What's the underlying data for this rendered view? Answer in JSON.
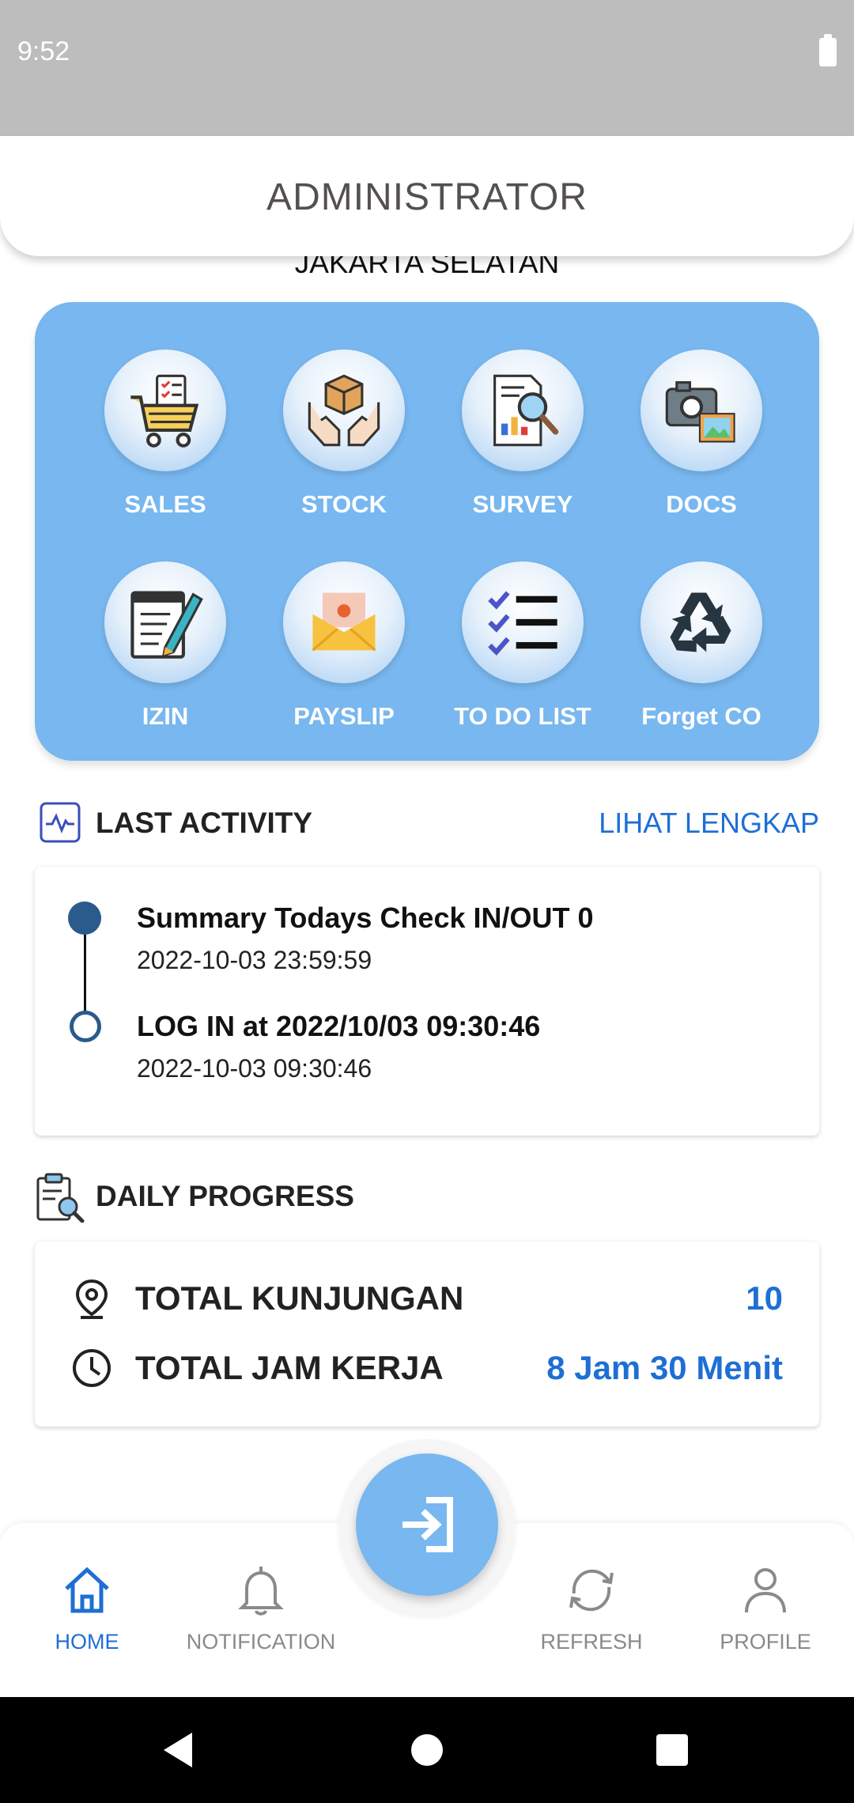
{
  "status_bar": {
    "time": "9:52"
  },
  "header": {
    "title": "ADMINISTRATOR",
    "subtitle": "JAKARTA SELATAN"
  },
  "menu": {
    "items": [
      {
        "label": "SALES",
        "icon": "shopping-cart-icon"
      },
      {
        "label": "STOCK",
        "icon": "box-in-hands-icon"
      },
      {
        "label": "SURVEY",
        "icon": "report-magnifier-icon"
      },
      {
        "label": "DOCS",
        "icon": "camera-photo-icon"
      },
      {
        "label": "IZIN",
        "icon": "notepad-pencil-icon"
      },
      {
        "label": "PAYSLIP",
        "icon": "envelope-money-icon"
      },
      {
        "label": "TO DO LIST",
        "icon": "checklist-icon"
      },
      {
        "label": "Forget CO",
        "icon": "recycle-icon"
      }
    ]
  },
  "last_activity": {
    "title": "LAST ACTIVITY",
    "see_all": "LIHAT LENGKAP",
    "items": [
      {
        "title": "Summary Todays Check IN/OUT 0",
        "time": "2022-10-03 23:59:59"
      },
      {
        "title": "LOG IN at 2022/10/03 09:30:46",
        "time": "2022-10-03 09:30:46"
      }
    ]
  },
  "daily_progress": {
    "title": "DAILY PROGRESS",
    "visits_label": "TOTAL KUNJUNGAN",
    "visits_value": "10",
    "hours_label": "TOTAL JAM KERJA",
    "hours_value": "8 Jam  30 Menit"
  },
  "bottom_nav": {
    "home": "HOME",
    "notification": "NOTIFICATION",
    "refresh": "REFRESH",
    "profile": "PROFILE"
  },
  "colors": {
    "accent": "#1e6fd4",
    "panel": "#78b7ef",
    "timeline": "#2a5b8c"
  }
}
